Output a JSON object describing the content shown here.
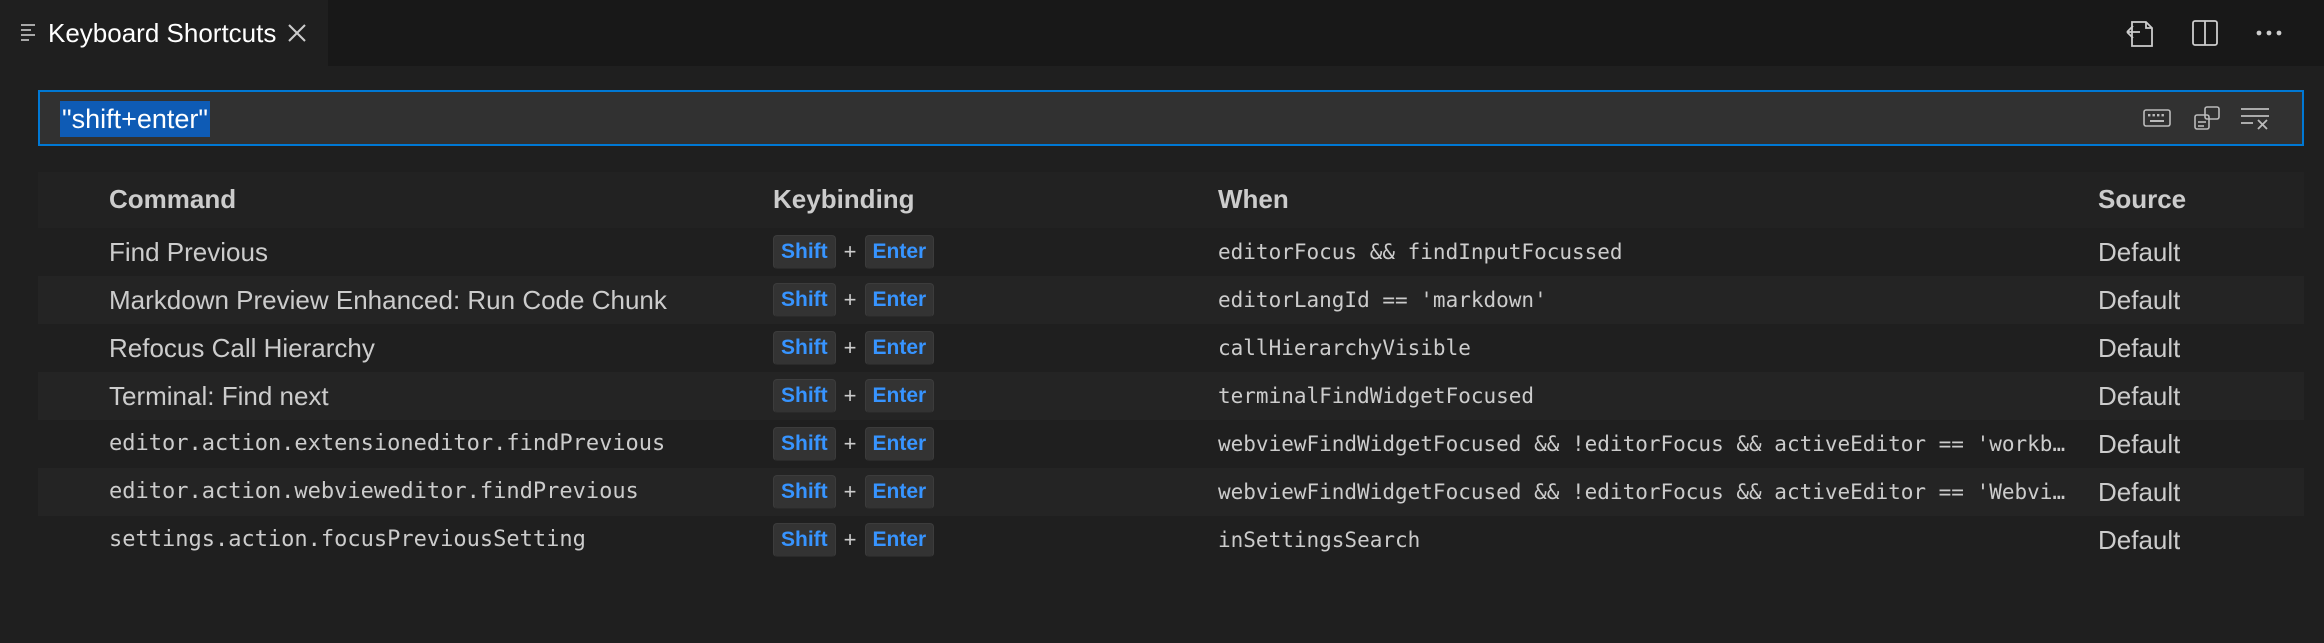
{
  "tab": {
    "title": "Keyboard Shortcuts"
  },
  "search": {
    "value": "\"shift+enter\""
  },
  "table": {
    "headers": {
      "command": "Command",
      "keybinding": "Keybinding",
      "when": "When",
      "source": "Source"
    },
    "rows": [
      {
        "command": "Find Previous",
        "mono": false,
        "key1": "Shift",
        "plus": "+",
        "key2": "Enter",
        "when": "editorFocus && findInputFocussed",
        "source": "Default"
      },
      {
        "command": "Markdown Preview Enhanced: Run Code Chunk",
        "mono": false,
        "key1": "Shift",
        "plus": "+",
        "key2": "Enter",
        "when": "editorLangId == 'markdown'",
        "source": "Default"
      },
      {
        "command": "Refocus Call Hierarchy",
        "mono": false,
        "key1": "Shift",
        "plus": "+",
        "key2": "Enter",
        "when": "callHierarchyVisible",
        "source": "Default"
      },
      {
        "command": "Terminal: Find next",
        "mono": false,
        "key1": "Shift",
        "plus": "+",
        "key2": "Enter",
        "when": "terminalFindWidgetFocused",
        "source": "Default"
      },
      {
        "command": "editor.action.extensioneditor.findPrevious",
        "mono": true,
        "key1": "Shift",
        "plus": "+",
        "key2": "Enter",
        "when": "webviewFindWidgetFocused && !editorFocus && activeEditor == 'workb…",
        "source": "Default"
      },
      {
        "command": "editor.action.webvieweditor.findPrevious",
        "mono": true,
        "key1": "Shift",
        "plus": "+",
        "key2": "Enter",
        "when": "webviewFindWidgetFocused && !editorFocus && activeEditor == 'Webvi…",
        "source": "Default"
      },
      {
        "command": "settings.action.focusPreviousSetting",
        "mono": true,
        "key1": "Shift",
        "plus": "+",
        "key2": "Enter",
        "when": "inSettingsSearch",
        "source": "Default"
      }
    ]
  },
  "icons": {
    "tab": "list-icon",
    "close": "close-icon",
    "open_json": "open-keyboard-shortcuts-json-icon",
    "split": "split-editor-icon",
    "more": "more-actions-icon",
    "record_keys": "record-keys-icon",
    "sort_precedence": "sort-by-precedence-icon",
    "clear": "clear-search-icon"
  },
  "colors": {
    "accent": "#0078d4",
    "key_text": "#3794ff",
    "selection": "#0e5bb5"
  }
}
